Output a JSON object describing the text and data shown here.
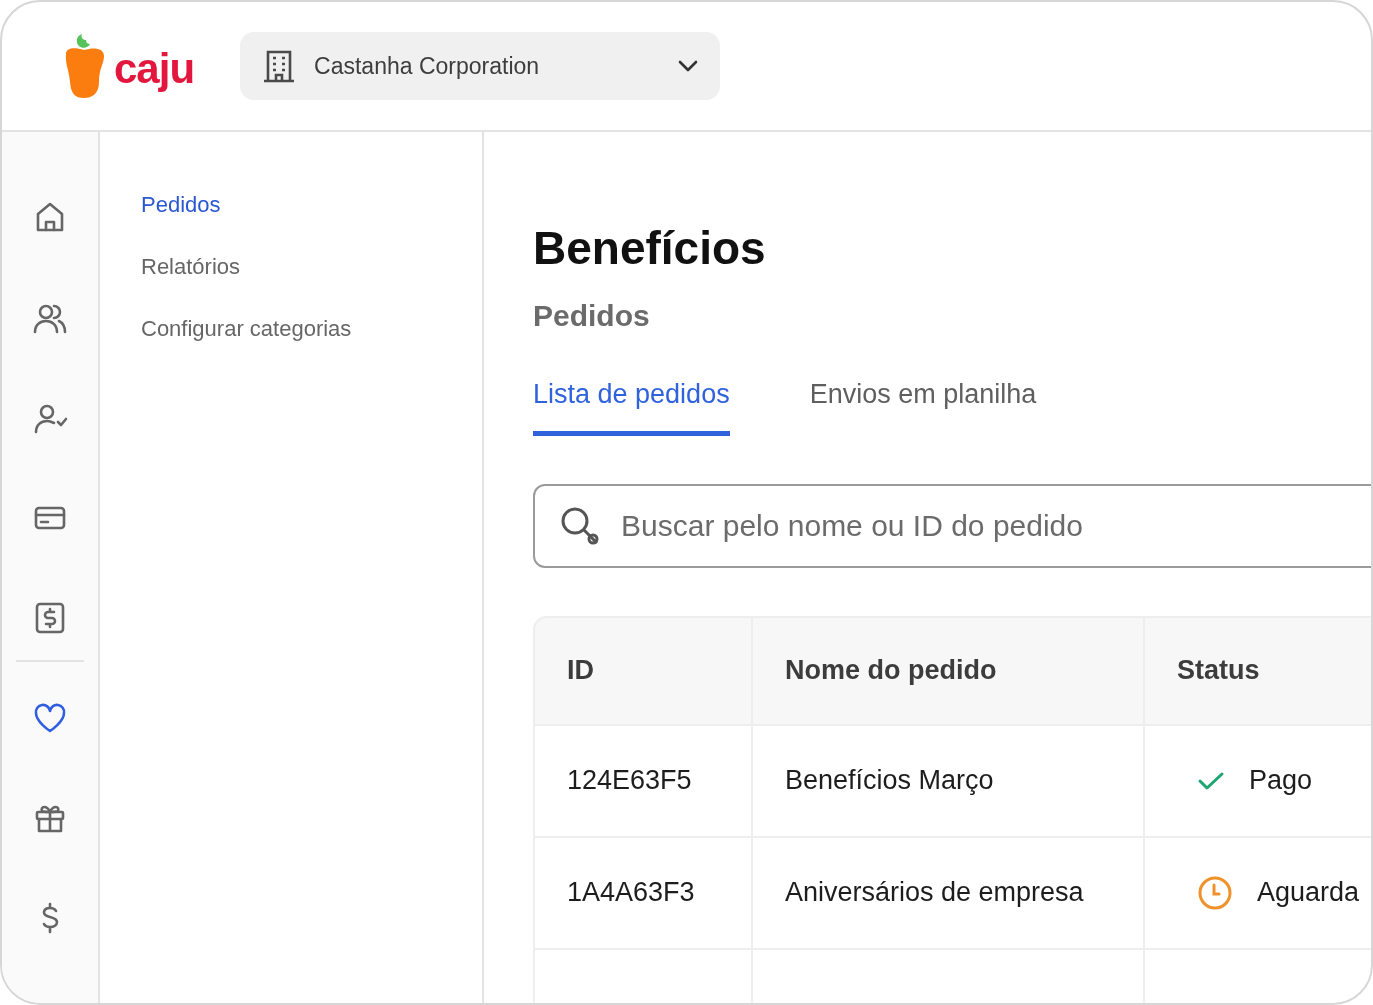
{
  "header": {
    "logo_text": "caju",
    "company_selector": {
      "label": "Castanha Corporation"
    }
  },
  "rail": [
    {
      "kind": "home",
      "selected": false
    },
    {
      "kind": "users",
      "selected": false
    },
    {
      "kind": "user-check",
      "selected": false
    },
    {
      "kind": "card",
      "selected": false
    },
    {
      "kind": "money-doc",
      "selected": false
    },
    {
      "kind": "divider"
    },
    {
      "kind": "heart",
      "selected": true
    },
    {
      "kind": "gift",
      "selected": false
    },
    {
      "kind": "dollar",
      "selected": false
    }
  ],
  "submenu": [
    {
      "label": "Pedidos",
      "selected": true
    },
    {
      "label": "Relatórios",
      "selected": false
    },
    {
      "label": "Configurar categorias",
      "selected": false
    }
  ],
  "page": {
    "title": "Benefícios",
    "subtitle": "Pedidos"
  },
  "tabs": [
    {
      "label": "Lista de pedidos",
      "selected": true
    },
    {
      "label": "Envios em planilha",
      "selected": false
    }
  ],
  "search": {
    "placeholder": "Buscar pelo nome ou ID do pedido"
  },
  "table": {
    "columns": [
      "ID",
      "Nome do pedido",
      "Status"
    ],
    "rows": [
      {
        "id": "124E63F5",
        "name": "Benefícios Março",
        "status": "Pago",
        "kind": "paid"
      },
      {
        "id": "1A4A63F3",
        "name": "Aniversários de empresa",
        "status": "Aguarda",
        "kind": "pending"
      }
    ]
  }
}
